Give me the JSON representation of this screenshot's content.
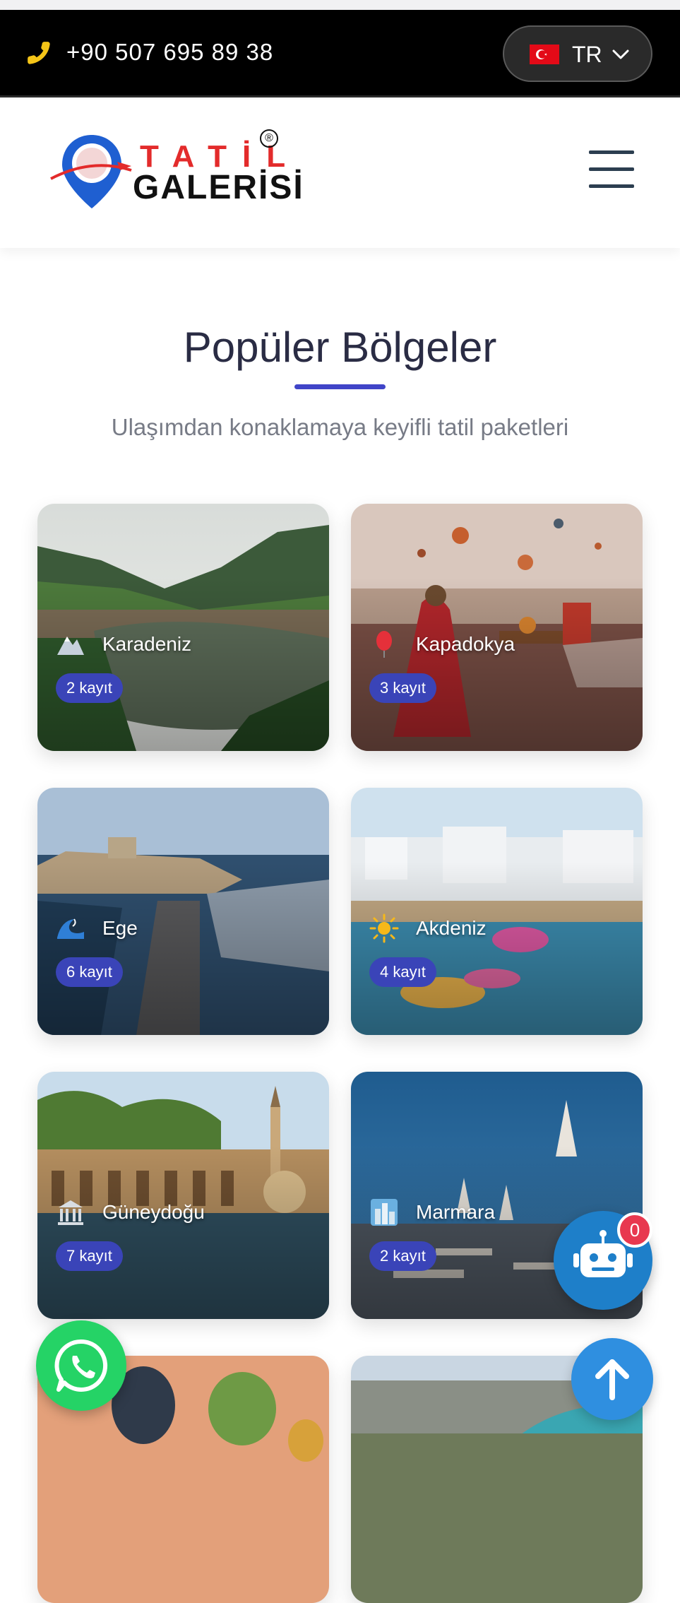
{
  "topbar": {
    "phone": "+90 507 695 89 38",
    "language": {
      "code": "TR",
      "flag_icon": "turkey-flag-icon"
    }
  },
  "logo": {
    "line1": "TATİL",
    "line2": "GALERİSİ",
    "registered": "®"
  },
  "section": {
    "title": "Popüler Bölgeler",
    "subtitle": "Ulaşımdan konaklamaya keyifli tatil paketleri"
  },
  "regions": [
    {
      "name": "Karadeniz",
      "count": "2 kayıt",
      "icon": "mountain-icon"
    },
    {
      "name": "Kapadokya",
      "count": "3 kayıt",
      "icon": "balloon-icon"
    },
    {
      "name": "Ege",
      "count": "6 kayıt",
      "icon": "wave-icon"
    },
    {
      "name": "Akdeniz",
      "count": "4 kayıt",
      "icon": "sun-icon"
    },
    {
      "name": "Güneydoğu",
      "count": "7 kayıt",
      "icon": "classical-building-icon"
    },
    {
      "name": "Marmara",
      "count": "2 kayıt",
      "icon": "cityscape-icon"
    }
  ],
  "chatbot": {
    "badge": "0"
  },
  "colors": {
    "accent": "#4045c8",
    "badge_bg": "#3a44b8",
    "phone_icon": "#f5c518",
    "whatsapp": "#25d366",
    "chatbot": "#1e7fc9",
    "scroll_top": "#2f8fe0"
  }
}
